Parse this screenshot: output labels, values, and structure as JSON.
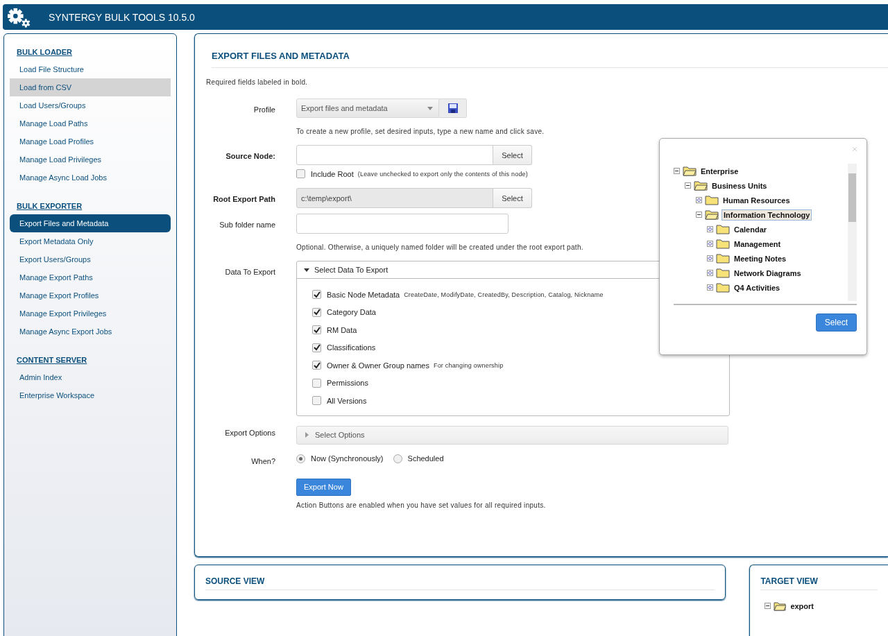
{
  "header": {
    "title": "SYNTERGY BULK TOOLS 10.5.0"
  },
  "sidebar": {
    "sections": [
      {
        "heading": "BULK LOADER",
        "items": [
          {
            "label": "Load File Structure",
            "selected": false,
            "hovered": false
          },
          {
            "label": "Load from CSV",
            "selected": false,
            "hovered": true
          },
          {
            "label": "Load Users/Groups",
            "selected": false,
            "hovered": false
          },
          {
            "label": "Manage Load Paths",
            "selected": false,
            "hovered": false
          },
          {
            "label": "Manage Load Profiles",
            "selected": false,
            "hovered": false
          },
          {
            "label": "Manage Load Privileges",
            "selected": false,
            "hovered": false
          },
          {
            "label": "Manage Async Load Jobs",
            "selected": false,
            "hovered": false
          }
        ]
      },
      {
        "heading": "BULK EXPORTER",
        "items": [
          {
            "label": "Export Files and Metadata",
            "selected": true,
            "hovered": false
          },
          {
            "label": "Export Metadata Only",
            "selected": false,
            "hovered": false
          },
          {
            "label": "Export Users/Groups",
            "selected": false,
            "hovered": false
          },
          {
            "label": "Manage Export Paths",
            "selected": false,
            "hovered": false
          },
          {
            "label": "Manage Export Profiles",
            "selected": false,
            "hovered": false
          },
          {
            "label": "Manage Export Privileges",
            "selected": false,
            "hovered": false
          },
          {
            "label": "Manage Async Export Jobs",
            "selected": false,
            "hovered": false
          }
        ]
      },
      {
        "heading": "CONTENT SERVER",
        "items": [
          {
            "label": "Admin Index",
            "selected": false,
            "hovered": false
          },
          {
            "label": "Enterprise Workspace",
            "selected": false,
            "hovered": false
          }
        ]
      }
    ]
  },
  "form": {
    "title": "EXPORT FILES AND METADATA",
    "note": "Required fields labeled in bold.",
    "profile": {
      "label": "Profile",
      "value": "Export files and metadata",
      "help": "To create a new profile, set desired inputs, type a new name and click save."
    },
    "source_node": {
      "label": "Source Node:",
      "button": "Select"
    },
    "include_root": {
      "label": "Include Root",
      "note": "(Leave unchecked to export only the contents of this node)",
      "checked": false
    },
    "root_export_path": {
      "label": "Root Export Path",
      "value": "c:\\temp\\export\\",
      "button": "Select"
    },
    "sub_folder": {
      "label": "Sub folder name",
      "help": "Optional. Otherwise, a uniquely named folder will be created under the root export path."
    },
    "data_to_export": {
      "label": "Data To Export",
      "header": "Select Data To Export",
      "expanded": true,
      "options": [
        {
          "label": "Basic Node Metadata",
          "note": "CreateDate, ModifyDate, CreatedBy, Description, Catalog, Nickname",
          "checked": true
        },
        {
          "label": "Category Data",
          "checked": true
        },
        {
          "label": "RM Data",
          "checked": true
        },
        {
          "label": "Classifications",
          "checked": true
        },
        {
          "label": "Owner & Owner Group names",
          "note": "For changing ownership",
          "checked": true
        },
        {
          "label": "Permissions",
          "checked": false
        },
        {
          "label": "All Versions",
          "checked": false
        }
      ]
    },
    "export_options": {
      "label": "Export Options",
      "header": "Select Options",
      "expanded": false
    },
    "when": {
      "label": "When?",
      "options": [
        {
          "label": "Now (Synchronously)",
          "selected": true
        },
        {
          "label": "Scheduled",
          "selected": false
        }
      ]
    },
    "export_button": "Export Now",
    "action_note": "Action Buttons are enabled when you have set values for all required inputs."
  },
  "dialog": {
    "tree": [
      {
        "label": "Enterprise",
        "expanded": true,
        "selected": false,
        "children": [
          {
            "label": "Business Units",
            "expanded": true,
            "selected": false,
            "children": [
              {
                "label": "Human Resources",
                "expanded": false,
                "selected": false
              },
              {
                "label": "Information Technology",
                "expanded": true,
                "selected": true,
                "children": [
                  {
                    "label": "Calendar",
                    "expanded": false,
                    "selected": false
                  },
                  {
                    "label": "Management",
                    "expanded": false,
                    "selected": false
                  },
                  {
                    "label": "Meeting Notes",
                    "expanded": false,
                    "selected": false
                  },
                  {
                    "label": "Network Diagrams",
                    "expanded": false,
                    "selected": false
                  },
                  {
                    "label": "Q4 Activities",
                    "expanded": false,
                    "selected": false
                  }
                ]
              }
            ]
          }
        ]
      }
    ],
    "button": "Select"
  },
  "source_view": {
    "title": "SOURCE VIEW"
  },
  "target_view": {
    "title": "TARGET VIEW",
    "tree": [
      {
        "label": "export",
        "expanded": true
      }
    ]
  }
}
